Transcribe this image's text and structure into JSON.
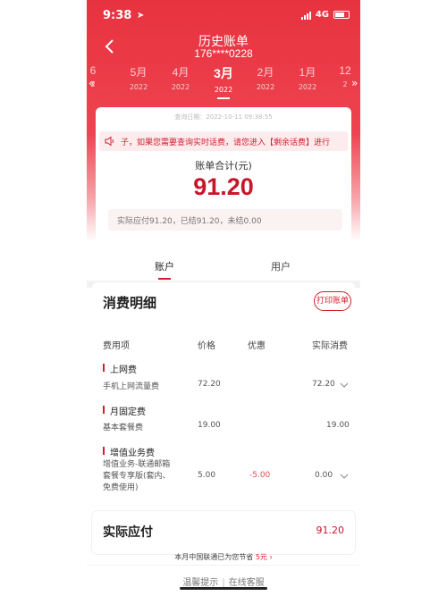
{
  "status_bar": {
    "time": "9:38",
    "network": "4G"
  },
  "header": {
    "title": "历史账单",
    "phone": "176****0228"
  },
  "months": [
    {
      "month": "6",
      "year": "2"
    },
    {
      "month": "5月",
      "year": "2022"
    },
    {
      "month": "4月",
      "year": "2022"
    },
    {
      "month": "3月",
      "year": "2022"
    },
    {
      "month": "2月",
      "year": "2022"
    },
    {
      "month": "1月",
      "year": "2022"
    },
    {
      "month": "12",
      "year": "2"
    }
  ],
  "bill": {
    "date": "查询日期：2022-10-11 09:38:55",
    "notice": "子，如果您需要查询实时话费，请您进入【剩余话费】进行",
    "caption": "账单合计(元)",
    "amount": "91.20",
    "paid_summary": "实际应付91.20，已结91.20，未结0.00"
  },
  "tabs": [
    {
      "label": "账户"
    },
    {
      "label": "用户"
    }
  ],
  "detail": {
    "heading": "消费明细",
    "print_label": "打印账单",
    "columns": {
      "item": "费用项",
      "price": "价格",
      "discount": "优惠",
      "actual": "实际消费"
    },
    "groups": [
      {
        "title": "上网费",
        "rows": [
          {
            "name": "手机上网流量费",
            "price": "72.20",
            "discount": "",
            "actual": "72.20"
          }
        ]
      },
      {
        "title": "月固定费",
        "rows": [
          {
            "name": "基本套餐费",
            "price": "19.00",
            "discount": "",
            "actual": "19.00"
          }
        ]
      },
      {
        "title": "增值业务费",
        "rows": [
          {
            "name": "增值业务-联通邮箱套餐专享版(套内、免费使用)",
            "name_lines": [
              "增值业务-联通邮箱",
              "套餐专享版(套内、",
              "免费使用)"
            ],
            "price": "5.00",
            "discount": "-5.00",
            "actual": "0.00"
          }
        ]
      }
    ]
  },
  "total": {
    "label": "实际应付",
    "value": "91.20"
  },
  "saving": {
    "text": "本月中国联通已为您节省",
    "amount": "5元"
  },
  "footer": {
    "tips": "温馨提示",
    "service": "在线客服"
  },
  "colors": {
    "brand_red": "#e8323f",
    "accent": "#c8162a"
  }
}
